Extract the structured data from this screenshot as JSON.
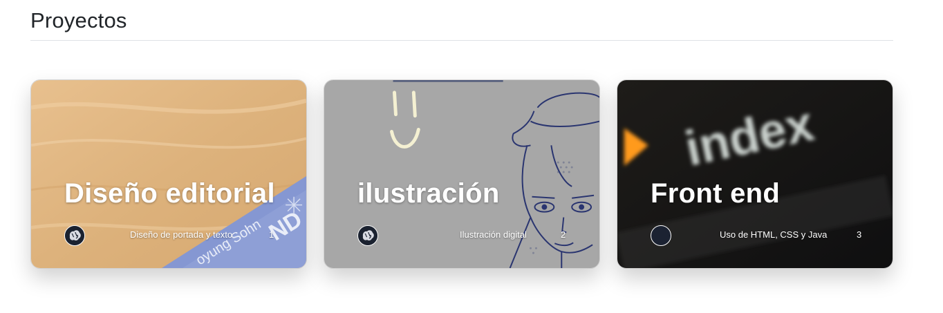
{
  "section": {
    "title": "Proyectos"
  },
  "colors": {
    "card_text": "#ffffff",
    "divider": "#dee2e6",
    "avatar_bg": "#1b2230"
  },
  "cards": [
    {
      "title": "Diseño editorial",
      "description": "Diseño de portada y texto",
      "count": "1",
      "background": "wooden desk with blue book cover",
      "avatar": "brain-avatar-icon"
    },
    {
      "title": "ilustración",
      "description": "Ilustración digital",
      "count": "2",
      "background": "pencil sketch of girl face",
      "avatar": "brain-avatar-icon"
    },
    {
      "title": "Front end",
      "description": "Uso de HTML, CSS y Java",
      "count": "3",
      "background": "blurred screen reading index",
      "bg_text": "index",
      "avatar": "empty-avatar-icon"
    }
  ]
}
